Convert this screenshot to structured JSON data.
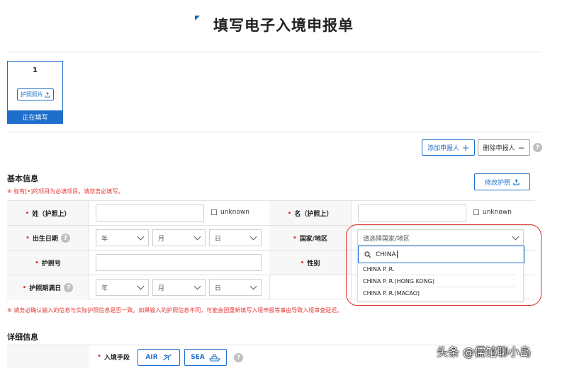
{
  "page": {
    "title": "填写电子入境申报单"
  },
  "applicant_card": {
    "number": "1",
    "photo_button": "护照照片",
    "status": "正在填写"
  },
  "actions": {
    "add": "添加申报人",
    "delete": "删除申报人",
    "modify_passport": "修改护照"
  },
  "basic": {
    "title": "基本信息",
    "note": "※ 标有[•]的项目为必填项目。请您务必填写。",
    "fields": {
      "surname": "姓（护照上）",
      "given_name": "名（护照上）",
      "unknown": "unknown",
      "birth_date": "出生日期",
      "country": "国家/地区",
      "passport_no": "护照号",
      "gender": "性别",
      "expiry": "护照期满日"
    },
    "date_placeholders": {
      "year": "年",
      "month": "月",
      "day": "日"
    },
    "warning": "※ 请务必确认输入的信息与实际护照信息是否一致。如果输入的护照信息不同，可能会因重新填写入境申报等事由导致入境审查延迟。"
  },
  "country_dropdown": {
    "placeholder": "请选择国家/地区",
    "search_value": "CHINA",
    "options": [
      "CHINA P. R.",
      "CHINA P. R.(HONG KONG)",
      "CHINA P. R.(MACAO)"
    ]
  },
  "detail": {
    "title": "详细信息",
    "entry_label": "入境手段",
    "modes": [
      "AIR",
      "SEA"
    ]
  },
  "watermark": "头条 @儒馆聊小岛",
  "colors": {
    "accent": "#1e6fcc",
    "required": "#e53935",
    "highlight": "#e0322d"
  }
}
